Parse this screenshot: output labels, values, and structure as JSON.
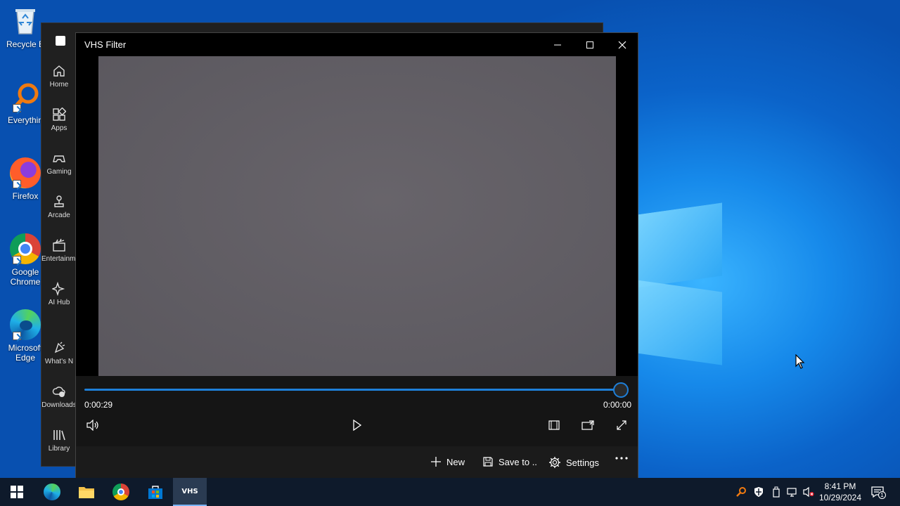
{
  "desktop": {
    "icons": [
      {
        "label": "Recycle B",
        "icon": "recycle-bin-icon"
      },
      {
        "label": "Everythin",
        "icon": "everything-search-icon"
      },
      {
        "label": "Firefox",
        "icon": "firefox-icon"
      },
      {
        "label": "Google Chrome",
        "icon": "chrome-icon"
      },
      {
        "label": "Microsoft Edge",
        "icon": "edge-icon"
      }
    ]
  },
  "store": {
    "nav": [
      {
        "label": "Home",
        "icon": "home-icon"
      },
      {
        "label": "Apps",
        "icon": "apps-icon"
      },
      {
        "label": "Gaming",
        "icon": "gamepad-icon"
      },
      {
        "label": "Arcade",
        "icon": "joystick-icon"
      },
      {
        "label": "Entertainment",
        "icon": "clapperboard-icon"
      },
      {
        "label": "AI Hub",
        "icon": "sparkle-icon"
      },
      {
        "label": "What's N",
        "icon": "whats-new-icon"
      },
      {
        "label": "Downloads",
        "icon": "cloud-download-icon"
      },
      {
        "label": "Library",
        "icon": "library-icon"
      }
    ]
  },
  "vhs": {
    "title": "VHS Filter",
    "player": {
      "elapsed": "0:00:29",
      "remaining": "0:00:00",
      "progress": 1.0
    },
    "commands": {
      "new_label": "New",
      "save_label": "Save to ..",
      "settings_label": "Settings"
    }
  },
  "taskbar": {
    "apps": [
      "windows-start-icon",
      "edge-icon",
      "file-explorer-icon",
      "chrome-icon",
      "store-icon",
      "vhs-app-icon"
    ],
    "vhs_app_label": "VHS",
    "time": "8:41 PM",
    "date": "10/29/2024",
    "notification_count": "1"
  },
  "colors": {
    "accent": "#1e7fd8",
    "video_bg": "#5f5c63"
  }
}
